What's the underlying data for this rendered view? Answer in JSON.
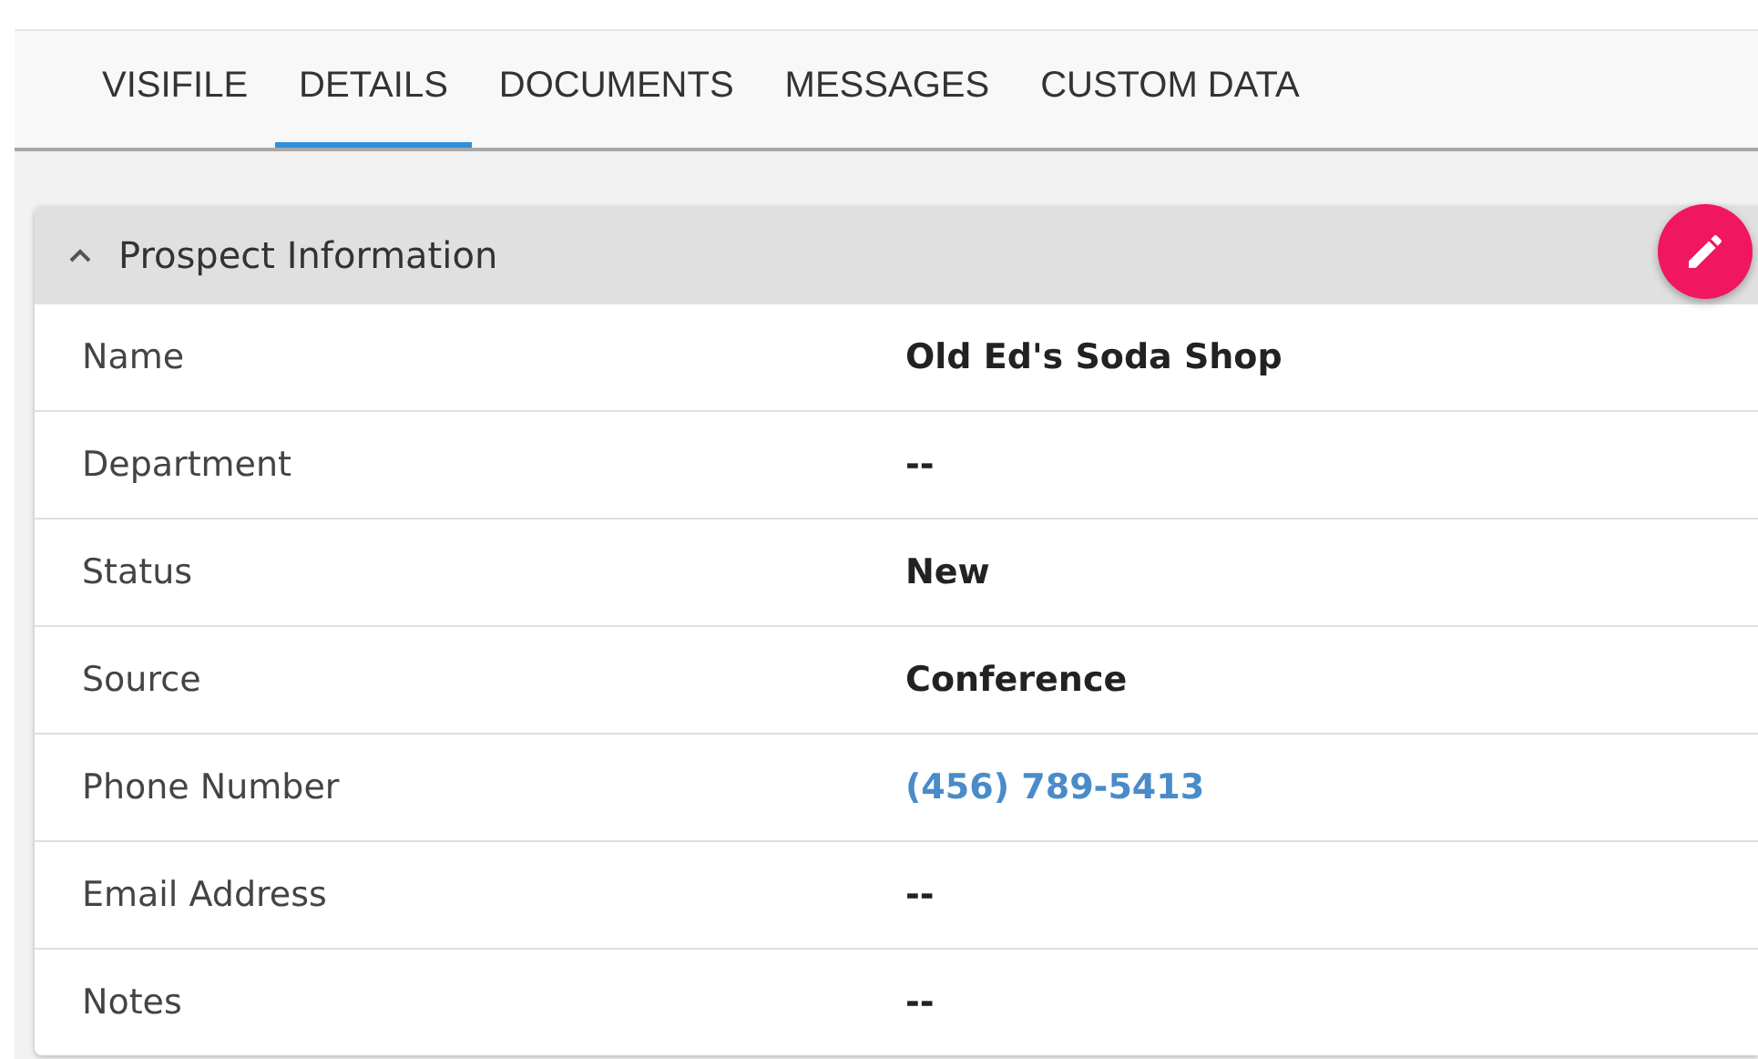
{
  "tabs": [
    {
      "label": "VISIFILE",
      "selected": false
    },
    {
      "label": "DETAILS",
      "selected": true
    },
    {
      "label": "DOCUMENTS",
      "selected": false
    },
    {
      "label": "MESSAGES",
      "selected": false
    },
    {
      "label": "CUSTOM DATA",
      "selected": false
    }
  ],
  "panel": {
    "title": "Prospect Information",
    "expanded": true,
    "fields": [
      {
        "label": "Name",
        "value": "Old Ed's Soda Shop",
        "kind": "text"
      },
      {
        "label": "Department",
        "value": "--",
        "kind": "text"
      },
      {
        "label": "Status",
        "value": "New",
        "kind": "text"
      },
      {
        "label": "Source",
        "value": "Conference",
        "kind": "text"
      },
      {
        "label": "Phone Number",
        "value": "(456) 789-5413",
        "kind": "link"
      },
      {
        "label": "Email Address",
        "value": "--",
        "kind": "text"
      },
      {
        "label": "Notes",
        "value": "--",
        "kind": "text"
      }
    ]
  }
}
